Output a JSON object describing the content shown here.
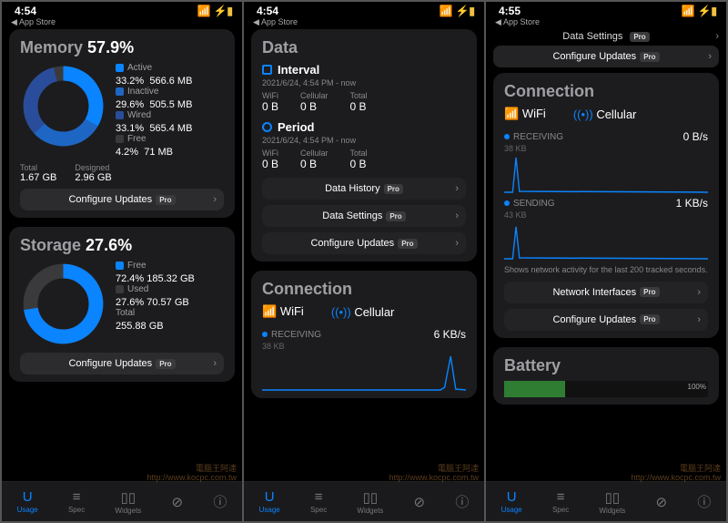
{
  "colors": {
    "accent": "#0a84ff",
    "active": "#0a84ff",
    "inactive": "#1e66c4",
    "wired": "#2a4d9b",
    "free": "#3a3a3c",
    "orange": "#f0a020"
  },
  "statusbar": {
    "time1": "4:54",
    "time2": "4:54",
    "time3": "4:55",
    "breadcrumb": "App Store"
  },
  "memory": {
    "title_label": "Memory",
    "title_pct": "57.9%",
    "legend": [
      {
        "name": "Active",
        "pct": "33.2%",
        "val": "566.6 MB",
        "color": "#0a84ff"
      },
      {
        "name": "Inactive",
        "pct": "29.6%",
        "val": "505.5 MB",
        "color": "#1e66c4"
      },
      {
        "name": "Wired",
        "pct": "33.1%",
        "val": "565.4 MB",
        "color": "#2a4d9b"
      },
      {
        "name": "Free",
        "pct": "4.2%",
        "val": "71 MB",
        "color": "#3a3a3c"
      }
    ],
    "total_label": "Total",
    "total": "1.67 GB",
    "designed_label": "Designed",
    "designed": "2.96 GB",
    "configure": "Configure Updates"
  },
  "storage": {
    "title_label": "Storage",
    "title_pct": "27.6%",
    "legend": [
      {
        "name": "Free",
        "pct": "72.4%",
        "val": "185.32 GB",
        "color": "#0a84ff"
      },
      {
        "name": "Used",
        "pct": "27.6%",
        "val": "70.57 GB",
        "color": "#3a3a3c"
      },
      {
        "name": "Total",
        "pct": "",
        "val": "255.88 GB",
        "color": ""
      }
    ],
    "configure": "Configure Updates"
  },
  "data": {
    "heading": "Data",
    "interval": {
      "label": "Interval",
      "ts": "2021/6/24, 4:54 PM - now",
      "cols": [
        "WiFi",
        "Cellular",
        "Total"
      ],
      "vals": [
        "0 B",
        "0 B",
        "0 B"
      ]
    },
    "period": {
      "label": "Period",
      "ts": "2021/6/24, 4:54 PM - now",
      "cols": [
        "WiFi",
        "Cellular",
        "Total"
      ],
      "vals": [
        "0 B",
        "0 B",
        "0 B"
      ]
    },
    "links": [
      "Data History",
      "Data Settings",
      "Configure Updates"
    ]
  },
  "connection": {
    "heading": "Connection",
    "wifi": "WiFi",
    "cellular": "Cellular",
    "recv_label": "RECEIVING",
    "recv_rate": "6 KB/s",
    "recv_sub": "38 KB",
    "recv_rate_b": "0 B/s",
    "recv_sub_b": "38 KB",
    "send_label": "SENDING",
    "send_rate": "1 KB/s",
    "send_sub": "43 KB",
    "note": "Shows network activity for the last 200 tracked seconds.",
    "links": [
      "Network Interfaces",
      "Configure Updates"
    ]
  },
  "top_tabs_3": {
    "title": "Data Settings",
    "configure": "Configure Updates"
  },
  "battery": {
    "heading": "Battery",
    "pct_label": "100%"
  },
  "tabbar": {
    "items": [
      "Usage",
      "Spec",
      "Widgets",
      "",
      "",
      ""
    ],
    "active_index": 0
  },
  "chart_data": {
    "memory_donut": {
      "type": "pie",
      "title": "Memory 57.9%",
      "series": [
        {
          "name": "Active",
          "value": 33.2
        },
        {
          "name": "Inactive",
          "value": 29.6
        },
        {
          "name": "Wired",
          "value": 33.1
        },
        {
          "name": "Free",
          "value": 4.2
        }
      ]
    },
    "storage_donut": {
      "type": "pie",
      "title": "Storage 27.6%",
      "series": [
        {
          "name": "Free",
          "value": 72.4
        },
        {
          "name": "Used",
          "value": 27.6
        }
      ]
    },
    "network_recv_sparkline": {
      "type": "line",
      "ylabel": "KB/s",
      "ylim": [
        0,
        6
      ],
      "values": [
        0,
        0,
        0,
        0,
        0,
        0,
        0,
        0,
        0,
        0,
        0,
        0,
        0,
        0,
        0,
        0,
        0,
        0,
        0,
        0,
        0,
        0,
        0,
        0.5,
        5.8,
        0.3
      ]
    },
    "network_send_sparkline": {
      "type": "line",
      "ylabel": "KB/s",
      "ylim": [
        0,
        1
      ],
      "values": [
        0,
        0,
        0,
        0,
        0,
        0,
        0,
        0,
        0,
        0,
        0,
        0,
        0,
        0,
        0,
        0,
        0,
        0,
        0,
        0,
        0,
        0,
        0,
        0.1,
        0.9,
        0.1
      ]
    }
  }
}
